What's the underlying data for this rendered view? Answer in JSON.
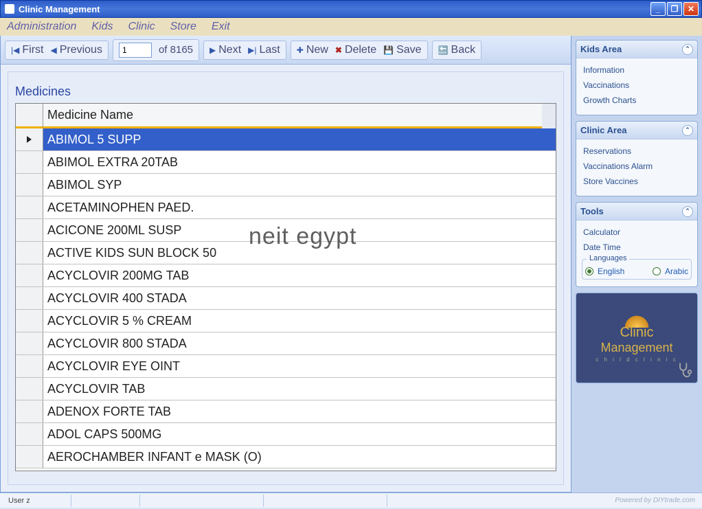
{
  "window": {
    "title": "Clinic Management"
  },
  "menu": {
    "administration": "Administration",
    "kids": "Kids",
    "clinic": "Clinic",
    "store": "Store",
    "exit": "Exit"
  },
  "nav": {
    "first": "First",
    "previous": "Previous",
    "page_value": "1",
    "of_label": "of 8165",
    "next": "Next",
    "last": "Last",
    "new": "New",
    "delete": "Delete",
    "save": "Save",
    "back": "Back"
  },
  "section": {
    "title": "Medicines",
    "column": "Medicine Name"
  },
  "rows": [
    "ABIMOL 5 SUPP",
    "ABIMOL EXTRA 20TAB",
    "ABIMOL SYP",
    "ACETAMINOPHEN PAED.",
    "ACICONE 200ML SUSP",
    "ACTIVE KIDS SUN BLOCK 50",
    "ACYCLOVIR 200MG TAB",
    "ACYCLOVIR 400 STADA",
    "ACYCLOVIR 5 % CREAM",
    "ACYCLOVIR 800 STADA",
    "ACYCLOVIR EYE OINT",
    "ACYCLOVIR TAB",
    "ADENOX FORTE TAB",
    "ADOL CAPS 500MG",
    "AEROCHAMBER INFANT e MASK (O)"
  ],
  "watermark": "neit  egypt",
  "panels": {
    "kids": {
      "title": "Kids Area",
      "links": [
        "Information",
        "Vaccinations",
        "Growth Charts"
      ]
    },
    "clinic": {
      "title": "Clinic Area",
      "links": [
        "Reservations",
        "Vaccinations Alarm",
        "Store Vaccines"
      ]
    },
    "tools": {
      "title": "Tools",
      "links": [
        "Calculator",
        "Date Time"
      ],
      "lang_label": "Languages",
      "english": "English",
      "arabic": "Arabic"
    }
  },
  "logo": {
    "line1": "Clinic",
    "line2": "Management",
    "line3": "c h i l d   c l i n i c"
  },
  "status": {
    "user": "User  z",
    "powered": "Powered by DIYtrade.com"
  }
}
